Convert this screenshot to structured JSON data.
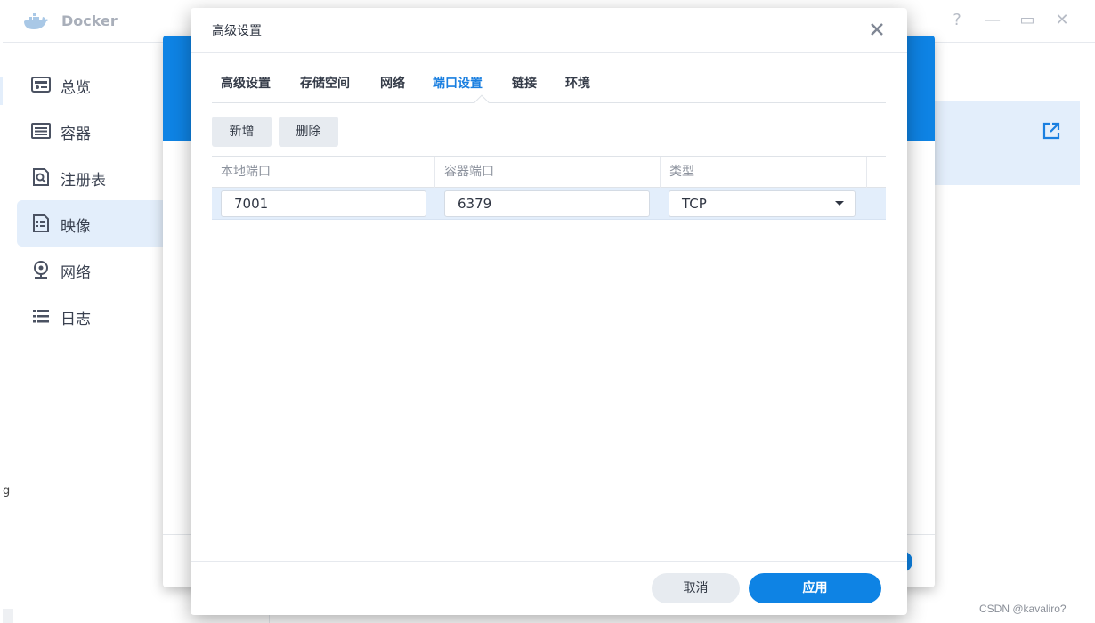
{
  "app": {
    "title": "Docker",
    "window_controls": [
      "?",
      "—",
      "▭",
      "✕"
    ]
  },
  "sidebar": {
    "items": [
      {
        "label": "总览",
        "icon": "dashboard-icon"
      },
      {
        "label": "容器",
        "icon": "container-icon"
      },
      {
        "label": "注册表",
        "icon": "registry-icon"
      },
      {
        "label": "映像",
        "icon": "image-icon",
        "active": true
      },
      {
        "label": "网络",
        "icon": "network-icon"
      },
      {
        "label": "日志",
        "icon": "log-icon"
      }
    ],
    "stray_text": "g"
  },
  "dialog": {
    "title": "高级设置",
    "tabs": [
      {
        "label": "高级设置"
      },
      {
        "label": "存储空间"
      },
      {
        "label": "网络"
      },
      {
        "label": "端口设置",
        "active": true
      },
      {
        "label": "链接"
      },
      {
        "label": "环境"
      }
    ],
    "toolbar": {
      "add_label": "新增",
      "delete_label": "删除"
    },
    "table": {
      "columns": [
        "本地端口",
        "容器端口",
        "类型"
      ],
      "rows": [
        {
          "local_port": "7001",
          "container_port": "6379",
          "type": "TCP"
        }
      ]
    },
    "footer": {
      "cancel_label": "取消",
      "apply_label": "应用"
    }
  },
  "colors": {
    "accent": "#0e83e4",
    "selection": "#e3eefb",
    "button_gray": "#e7ebf0"
  },
  "watermark": "CSDN @kavaliro?"
}
